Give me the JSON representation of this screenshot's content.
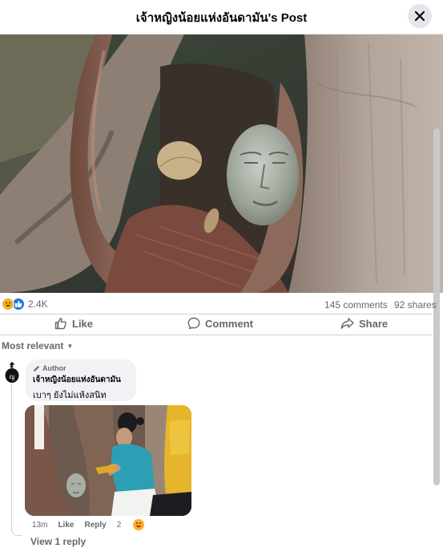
{
  "header": {
    "title": "เจ้าหญิงน้อยแห่งอันดามัน's Post",
    "close_icon": "close-icon"
  },
  "post": {
    "image_icon": "post-photo",
    "reaction_count": "2.4K",
    "comments_count": "145 comments",
    "shares_count": "92 shares",
    "reaction_icons": [
      "haha-icon",
      "like-icon"
    ]
  },
  "actions": {
    "like": "Like",
    "comment": "Comment",
    "share": "Share"
  },
  "sort": {
    "label": "Most relevant"
  },
  "comment": {
    "badge": "Author",
    "name": "เจ้าหญิงน้อยแห่งอันดามัน",
    "text": "เบาๆ ยังไม่แห้งสนิท",
    "time": "13m",
    "like": "Like",
    "reply": "Reply",
    "reaction_count": "2",
    "avatar_letter": "ญ"
  },
  "replies": {
    "label": "View 1 reply"
  },
  "colors": {
    "accent": "#1877f2",
    "haha": "#f7b125",
    "muted": "#65676b",
    "bubble": "#f0f2f5"
  }
}
